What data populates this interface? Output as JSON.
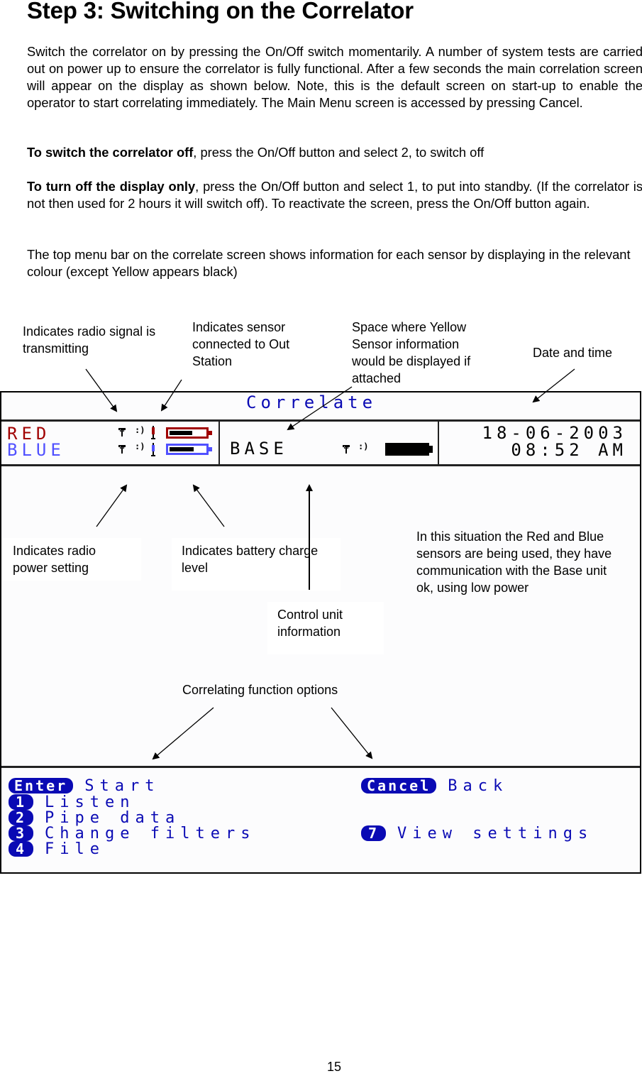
{
  "document": {
    "title": "Step 3:  Switching on the Correlator",
    "paragraphs": {
      "intro": "Switch the correlator on by pressing the On/Off switch momentarily.  A number of system tests are carried out on power up to ensure the correlator is fully functional.  After a few seconds the main correlation screen will appear on the display as shown below.  Note, this is the default screen on start-up to enable the operator to start correlating immediately.  The Main Menu screen is accessed by pressing Cancel.",
      "switch_off_bold": "To switch the correlator off",
      "switch_off_rest": ", press the On/Off button and select 2, to switch off",
      "display_off_bold": "To turn off the display only",
      "display_off_rest": ", press the On/Off button and select 1, to put into standby.  (If the correlator is not then used for 2 hours it will switch off). To reactivate the screen, press the On/Off button again.",
      "top_menu": "The top menu bar on the correlate screen shows information for each sensor by displaying in the relevant colour (except Yellow appears black)"
    },
    "page_number": "15"
  },
  "callouts": {
    "radio_signal": "Indicates radio signal is transmitting",
    "sensor_connected": "Indicates sensor connected to Out Station",
    "yellow_space": "Space where Yellow Sensor information would be displayed if attached",
    "date_time": "Date and time",
    "radio_power": "Indicates radio power setting",
    "battery_charge": "Indicates battery charge level",
    "control_unit": "Control unit information",
    "situation_note": "In this situation the Red and Blue sensors are being used, they have communication with the Base unit ok, using low power",
    "function_options": "Correlating function options"
  },
  "screen": {
    "title": "Correlate",
    "sensors": [
      {
        "name": "RED",
        "color": "#a00000",
        "battery_level": 0.6,
        "icons": [
          "antenna-icon",
          "radio-power-icon",
          "link-icon",
          "battery-icon"
        ]
      },
      {
        "name": "BLUE",
        "color": "#5050ff",
        "battery_level": 0.62,
        "icons": [
          "antenna-icon",
          "radio-power-icon",
          "link-icon",
          "battery-icon"
        ]
      }
    ],
    "base": {
      "name": "BASE",
      "battery_level": 1.0,
      "icons": [
        "antenna-icon",
        "radio-power-icon",
        "battery-icon"
      ]
    },
    "date": "18-06-2003",
    "time": "08:52 AM",
    "menu": {
      "left": [
        {
          "key": "Enter",
          "label": "Start"
        },
        {
          "key": "1",
          "label": "Listen"
        },
        {
          "key": "2",
          "label": "Pipe data"
        },
        {
          "key": "3",
          "label": "Change filters"
        },
        {
          "key": "4",
          "label": "File"
        }
      ],
      "right": [
        {
          "key": "Cancel",
          "label": "Back"
        },
        {
          "key": "7",
          "label": "View settings"
        }
      ]
    },
    "colors": {
      "menu_blue": "#0a0ab4",
      "red": "#a00000",
      "blue": "#5050ff"
    }
  }
}
